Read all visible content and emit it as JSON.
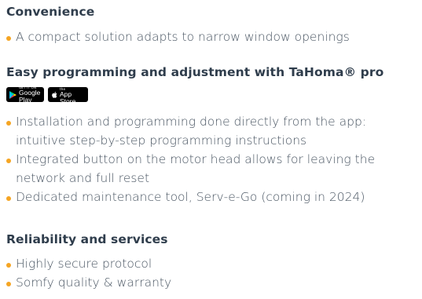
{
  "sections": [
    {
      "heading": "Convenience",
      "bullets": [
        "A compact solution adapts to narrow window openings"
      ]
    },
    {
      "heading": "Easy programming and adjustment with TaHoma® pro",
      "badges": {
        "google_play": {
          "small": "GET IT ON",
          "big": "Google Play",
          "icon": "google-play-icon"
        },
        "app_store": {
          "small": "Download on the",
          "big": "App Store",
          "icon": "apple-icon"
        }
      },
      "bullets": [
        "Installation and programming done directly from the app: intuitive step-by-step programming instructions",
        "Integrated button on the motor head allows for leaving the network and full reset",
        "Dedicated maintenance tool, Serv-e-Go (coming in 2024)"
      ]
    },
    {
      "heading": "Reliability and services",
      "bullets": [
        "Highly secure protocol",
        "Somfy quality & warranty"
      ]
    }
  ],
  "colors": {
    "bullet": "#f5a523",
    "heading": "#2f3d4c",
    "text": "#4a5663"
  }
}
